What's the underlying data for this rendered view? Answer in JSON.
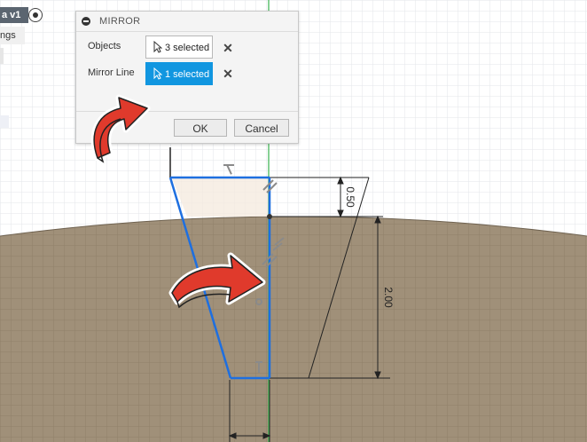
{
  "document": {
    "tab_label": "a v1",
    "settings_label": "ngs"
  },
  "dialog": {
    "title": "MIRROR",
    "objects_label": "Objects",
    "objects_value": "3 selected",
    "mirror_line_label": "Mirror Line",
    "mirror_line_value": "1 selected",
    "ok_label": "OK",
    "cancel_label": "Cancel"
  },
  "sketch": {
    "dimensions": {
      "top_height": "0.50",
      "side_height": "2.00"
    }
  },
  "colors": {
    "accent": "#1196e0",
    "sketch_line": "#1e6fe0",
    "ground": "#a09079",
    "mirror_axis": "#37b24d",
    "arrow_red": "#e03a2c"
  },
  "icons": [
    "collapse-icon",
    "cursor-icon",
    "close-icon",
    "radio-icon",
    "red-curved-arrow-icon",
    "horizontal-constraint-icon",
    "parallel-constraint-icon",
    "coincident-constraint-icon"
  ]
}
